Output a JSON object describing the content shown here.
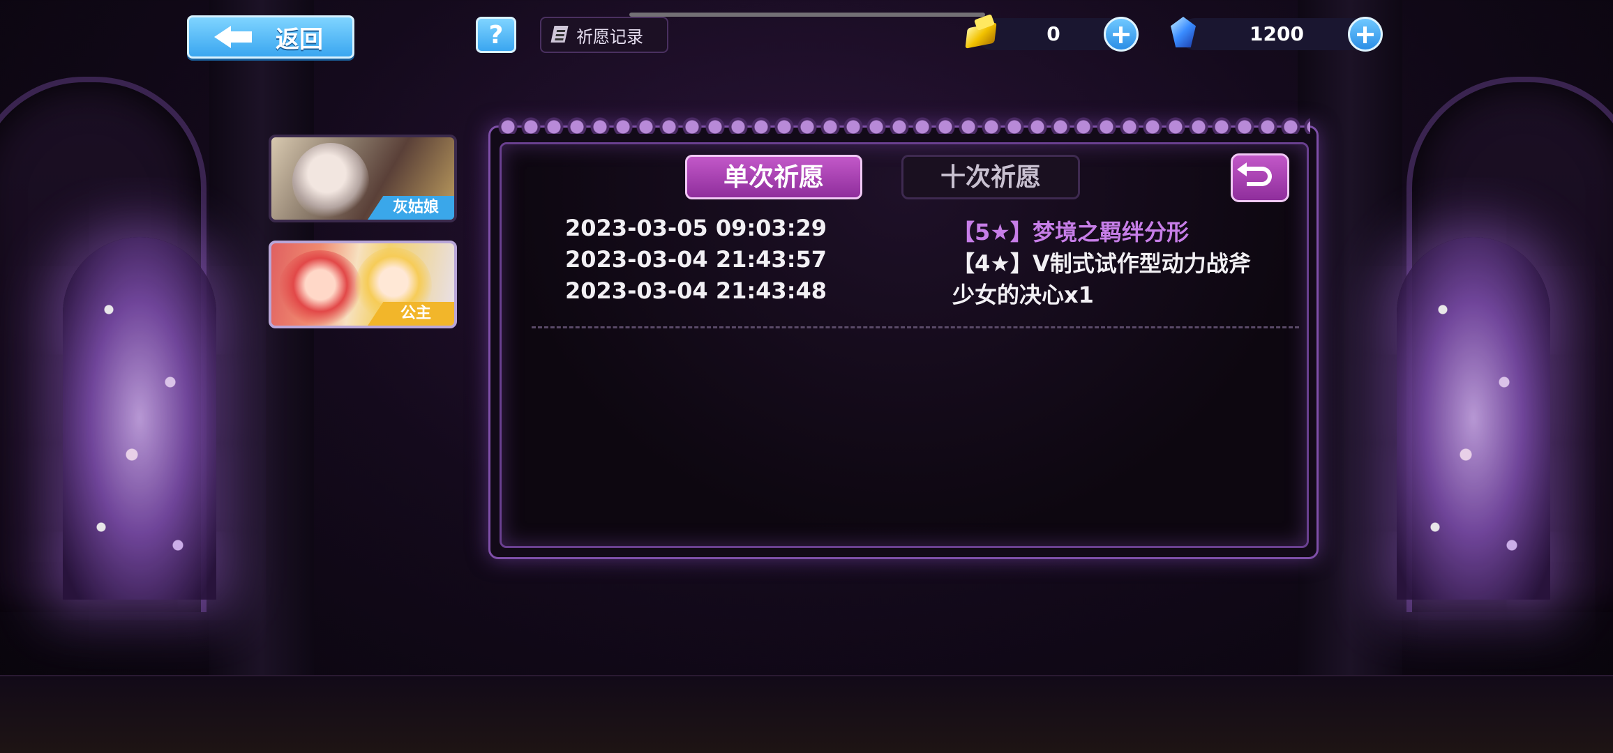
{
  "topbar": {
    "back_label": "返回",
    "help_label": "?",
    "record_label": "祈愿记录"
  },
  "currency": {
    "gold_value": "0",
    "gem_value": "1200"
  },
  "banners": [
    {
      "tag": "灰姑娘"
    },
    {
      "tag": "公主"
    }
  ],
  "tabs": {
    "single": "单次祈愿",
    "ten": "十次祈愿",
    "active": "single"
  },
  "records": [
    {
      "time": "2023-03-05 09:03:29",
      "item": "【5★】梦境之羁绊分形",
      "rarity": "5"
    },
    {
      "time": "2023-03-04 21:43:57",
      "item": "【4★】V制式试作型动力战斧",
      "rarity": "4"
    },
    {
      "time": "2023-03-04 21:43:48",
      "item": "少女的决心x1",
      "rarity": ""
    }
  ],
  "colors": {
    "accent_purple": "#a93fb4",
    "rarity5_text": "#c77ee8",
    "button_blue": "#3aa6f0",
    "tag_blue": "#3aa7ea",
    "tag_gold": "#f2b62a"
  }
}
